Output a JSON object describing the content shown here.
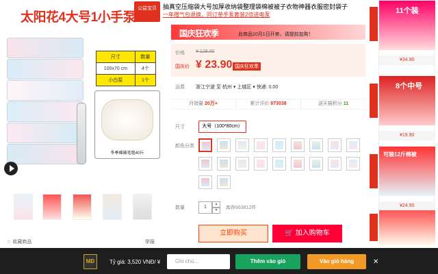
{
  "gallery": {
    "title": "太阳花4大号1小手泵",
    "badge": "公益宝贝",
    "spec_headers": [
      "尺寸",
      "数量"
    ],
    "spec_rows": [
      [
        "100x70 cm",
        "4个"
      ],
      [
        "小白泵",
        "1个"
      ]
    ],
    "quilt_caption": "冬季棉被毛毯40斤"
  },
  "favorite_label": "收藏商品",
  "report_label": "举报",
  "product": {
    "title": "抽真空压缩袋大号加厚收纳袋整理袋棉被被子衣物神器衣服密封袋子",
    "subtitle": "一年赠气包退换，同订单手泵套装2倍送电泵"
  },
  "promo": {
    "label": "国庆狂欢季",
    "note": "此商品10月1日开卖，请提前加购！"
  },
  "price": {
    "label": "价格",
    "original": "¥ 129.00",
    "sale_label": "国庆价",
    "sale_value": "¥ 23.90",
    "sale_badge": "国庆狂欢季"
  },
  "shipping": {
    "label": "运费",
    "text": "浙江宁波  至 杭州 ▾ 上城区 ▾  快递: 0.00"
  },
  "stats": {
    "monthly_label": "月销量",
    "monthly_value": "20万+",
    "reviews_label": "累计评价",
    "reviews_value": "873038",
    "points_label": "送天猫积分",
    "points_value": "11"
  },
  "options": {
    "size_label": "尺寸",
    "size_value": "大号（100*80cm）",
    "color_label": "颜色分类",
    "qty_label": "数量",
    "qty_value": "1",
    "stock": "库存663812件"
  },
  "actions": {
    "buy": "立即购买",
    "cart": "加入购物车"
  },
  "side_ads": [
    {
      "title": "11个装",
      "price": "¥34.90"
    },
    {
      "title": "8个中号",
      "price": "¥19.90"
    },
    {
      "title": "可装12斤棉被",
      "price": "¥24.90"
    }
  ],
  "bar": {
    "logo": "MĐ",
    "rate": "Tỷ giá: 3,520 VNĐ/ ¥",
    "note_placeholder": "Ghi chú...",
    "add_label": "Thêm vào giỏ",
    "cart_label": "Vào giỏ hàng",
    "close": "✕"
  }
}
